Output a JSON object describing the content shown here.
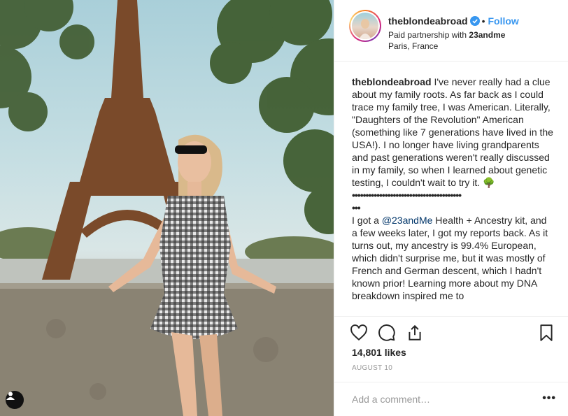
{
  "post": {
    "username": "theblondeabroad",
    "follow_label": "Follow",
    "dot": "•",
    "partnership_prefix": "Paid partnership with ",
    "partner": "23andme",
    "location": "Paris, France"
  },
  "caption": {
    "username": "theblondeabroad",
    "para1": " I've never really had a clue about my family roots. As far back as I could trace my family tree, I was American. Literally, \"Daughters of the Revolution\" American (something like 7 generations have lived in the USA!). I no longer have living grandparents and past generations weren't really discussed in my family, so when I learned about genetic testing, I couldn't wait to try it. 🌳",
    "dots1": "••••••••••••••••••••••••••••••••••••••••",
    "dots2": "•••",
    "para2_prefix": "I got a ",
    "para2_mention": "@23andMe",
    "para2_rest": " Health + Ancestry kit, and a few weeks later, I got my reports back. As it turns out, my ancestry is 99.4% European, which didn't surprise me, but it was mostly of French and German descent, which I hadn't known prior! Learning more about my DNA breakdown inspired me to"
  },
  "stats": {
    "likes": "14,801 likes",
    "date": "AUGUST 10"
  },
  "comment": {
    "placeholder": "Add a comment…",
    "more": "•••"
  },
  "icons": {
    "like": "heart-icon",
    "comment": "comment-icon",
    "share": "share-icon",
    "save": "bookmark-icon",
    "verified": "verified-badge-icon",
    "tagged": "user-tag-icon"
  },
  "colors": {
    "link_blue": "#3897f0",
    "text": "#262626",
    "muted": "#999999"
  }
}
